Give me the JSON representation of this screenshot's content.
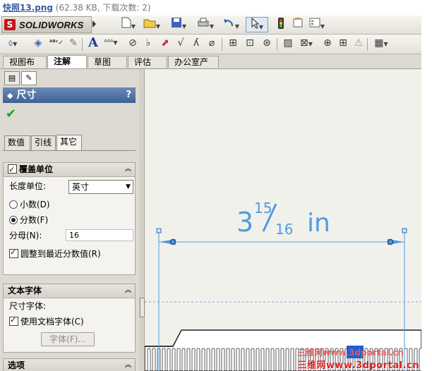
{
  "caption": {
    "filename": "快照13.png",
    "meta": " (62.38 KB, 下载次数: 2)"
  },
  "app": {
    "logo_text": "SOLIDWORKS"
  },
  "command_tabs": [
    {
      "label": "视图布局"
    },
    {
      "label": "注解"
    },
    {
      "label": "草图"
    },
    {
      "label": "评估"
    },
    {
      "label": "办公室产品"
    }
  ],
  "property_manager": {
    "title": "尺寸",
    "help": "?",
    "sub_tabs": [
      {
        "label": "数值"
      },
      {
        "label": "引线"
      },
      {
        "label": "其它"
      }
    ],
    "override_units": {
      "header": "覆盖单位",
      "length_unit_label": "长度单位:",
      "length_unit_value": "英寸",
      "decimal_label": "小数(D)",
      "fraction_label": "分数(F)",
      "denominator_label": "分母(N):",
      "denominator_value": "16",
      "round_label": "圆整到最近分数值(R)"
    },
    "text_font": {
      "header": "文本字体",
      "dim_font_label": "尺寸字体:",
      "use_doc_font_label": "使用文档字体(C)",
      "font_button": "字体(F)..."
    },
    "options": {
      "header": "选项"
    }
  },
  "drawing": {
    "dimension_whole": "3",
    "dimension_numerator": "15",
    "dimension_denominator": "16",
    "dimension_unit": "in",
    "dimension_color": "#4f9be2"
  },
  "watermark": {
    "text": "三维网www.3dportal.cn"
  },
  "colors": {
    "title_bar": "#3e6296",
    "check_green": "#23a02a",
    "part_blue": "#1f5fd6"
  }
}
